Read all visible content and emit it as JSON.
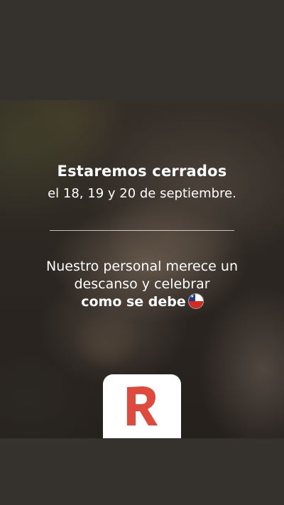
{
  "announcement": {
    "headline": "Estaremos cerrados",
    "dates": "el 18, 19 y 20 de septiembre.",
    "message_line1": "Nuestro personal merece un",
    "message_line2": "descanso y celebrar",
    "message_line3": "como se debe"
  },
  "icons": {
    "flag": "chile-flag-icon",
    "logo": "r-logo-icon"
  },
  "colors": {
    "background": "#35322e",
    "text": "#ffffff",
    "logo_red": "#e04a3c",
    "card": "#ffffff"
  }
}
